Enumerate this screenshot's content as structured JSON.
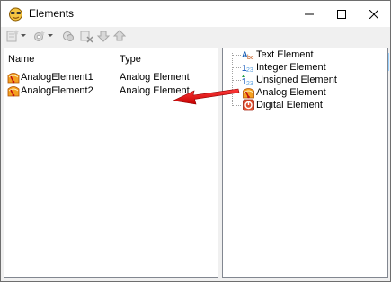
{
  "window": {
    "title": "Elements"
  },
  "toolbar": {
    "left_icons": [
      "new-element-icon",
      "new-element-dropdown-icon",
      "settings-icon",
      "settings-dropdown-icon",
      "copy-icon",
      "delete-icon",
      "move-down-icon",
      "move-up-icon"
    ],
    "search": {
      "value": "",
      "placeholder": ""
    },
    "right_icons": [
      "filter-icon",
      "tag-filter-icon",
      "number-display-icon"
    ]
  },
  "list": {
    "columns": [
      "Name",
      "Type"
    ],
    "rows": [
      {
        "name": "AnalogElement1",
        "type": "Analog Element",
        "icon": "analog-element-icon"
      },
      {
        "name": "AnalogElement2",
        "type": "Analog Element",
        "icon": "analog-element-icon"
      }
    ]
  },
  "tree": {
    "items": [
      {
        "label": "Text Element",
        "icon": "text-element-icon"
      },
      {
        "label": "Integer Element",
        "icon": "integer-element-icon"
      },
      {
        "label": "Unsigned Element",
        "icon": "unsigned-element-icon"
      },
      {
        "label": "Analog Element",
        "icon": "analog-element-icon"
      },
      {
        "label": "Digital Element",
        "icon": "digital-element-icon"
      }
    ]
  },
  "colors": {
    "arrow": "#e02020",
    "selected_toggle_bg": "#cce8ff",
    "pane_border": "#828790"
  }
}
